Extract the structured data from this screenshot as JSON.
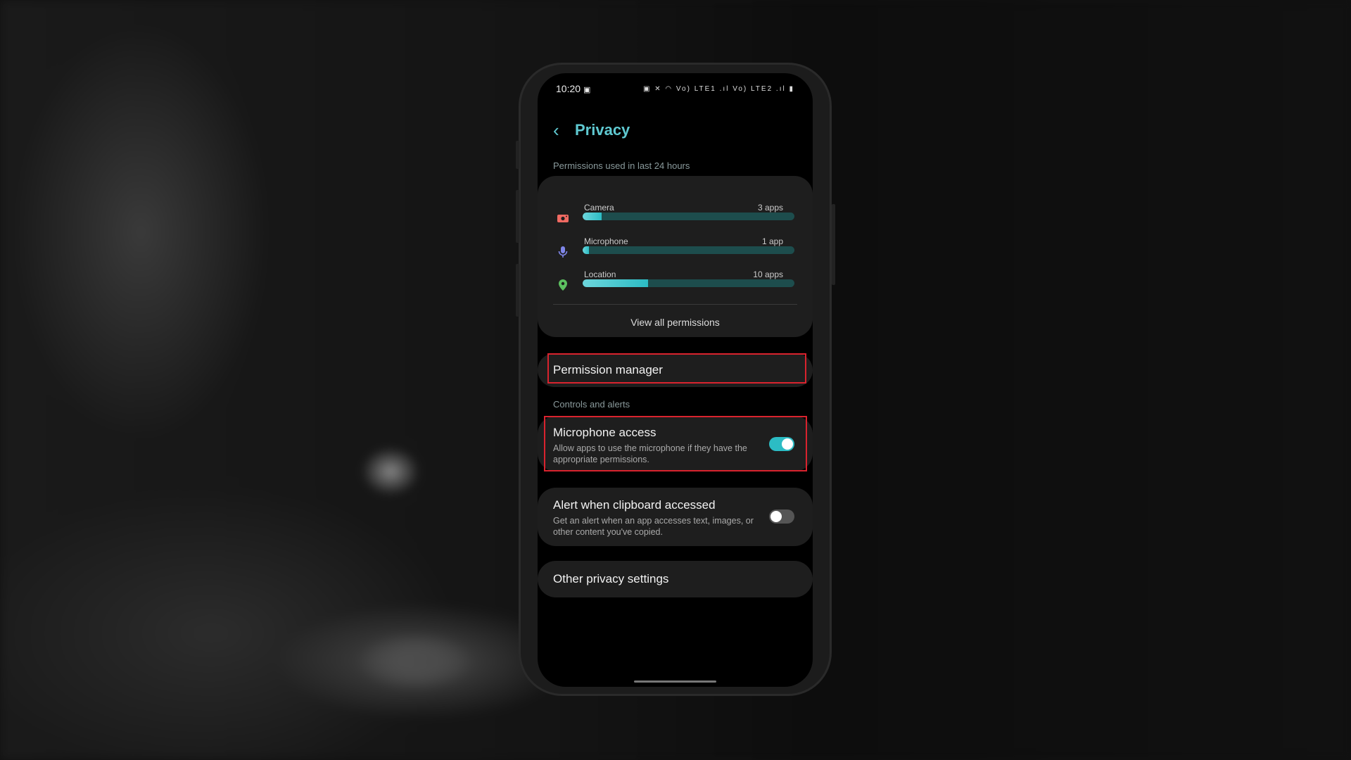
{
  "status_bar": {
    "time": "10:20",
    "icons": [
      "gallery-icon",
      "battery-saver-icon",
      "mute-icon",
      "wifi-icon",
      "volte-lte1-icon",
      "signal-icon",
      "volte-lte2-icon",
      "signal-icon",
      "battery-icon"
    ],
    "right_text": "Vo) LTE1 .ıl Vo) LTE2 .ıl"
  },
  "header": {
    "title": "Privacy"
  },
  "usage": {
    "section_label": "Permissions used in last 24 hours",
    "items": [
      {
        "label": "Camera",
        "count": "3 apps",
        "fill_percent": 9,
        "icon": "camera-icon",
        "color": "#f06a62"
      },
      {
        "label": "Microphone",
        "count": "1 app",
        "fill_percent": 3,
        "icon": "microphone-icon",
        "color": "#7f86e8"
      },
      {
        "label": "Location",
        "count": "10 apps",
        "fill_percent": 31,
        "icon": "location-icon",
        "color": "#5cc060"
      }
    ],
    "view_all": "View all permissions"
  },
  "permission_manager": {
    "label": "Permission manager"
  },
  "controls": {
    "section_label": "Controls and alerts",
    "microphone_access": {
      "title": "Microphone access",
      "subtitle": "Allow apps to use the microphone if they have the appropriate permissions.",
      "enabled": true
    },
    "clipboard_alert": {
      "title": "Alert when clipboard accessed",
      "subtitle": "Get an alert when an app accesses text, images, or other content you've copied.",
      "enabled": false
    }
  },
  "other": {
    "label": "Other privacy settings"
  },
  "colors": {
    "accent": "#5fc9d1",
    "highlight": "#d9232e"
  }
}
